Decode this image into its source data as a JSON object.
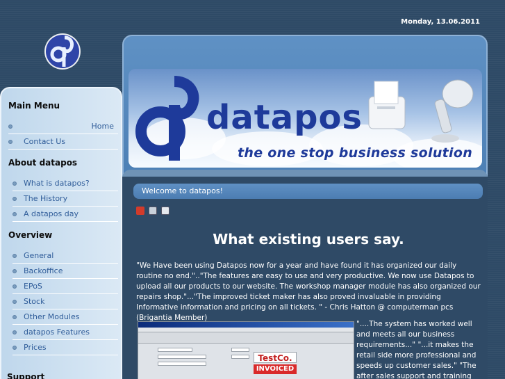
{
  "header": {
    "date": "Monday, 13.06.2011"
  },
  "banner": {
    "brand_word": "datapos",
    "tagline": "the one stop business solution"
  },
  "sidebar": {
    "sections": [
      {
        "heading": "Main Menu",
        "items": [
          {
            "label": "Home"
          },
          {
            "label": "Contact Us"
          }
        ]
      },
      {
        "heading": "About datapos",
        "items": [
          {
            "label": "What is datapos?"
          },
          {
            "label": "The History"
          },
          {
            "label": "A datapos day"
          }
        ]
      },
      {
        "heading": "Overview",
        "items": [
          {
            "label": "General"
          },
          {
            "label": "Backoffice"
          },
          {
            "label": "EPoS"
          },
          {
            "label": "Stock"
          },
          {
            "label": "Other Modules"
          },
          {
            "label": "datapos Features"
          },
          {
            "label": "Prices"
          }
        ]
      }
    ],
    "support_heading": "Support"
  },
  "content": {
    "welcome": "Welcome to datapos!",
    "icons": [
      "pdf-icon",
      "print-icon",
      "email-icon"
    ],
    "heading": "What existing users say.",
    "quote1": "\"We Have been using Datapos now for a year and have found it has organized our daily routine no end.\"..\"The  features are easy to use and very productive.  We now use Datapos to upload all our products to our website. The workshop manager module has also organized our repairs shop.\"...\"The improved ticket maker has also proved invaluable in providing Informative information and pricing on all tickets. \" - Chris Hatton @ computerman pcs (Brigantia Member)",
    "quote2": "\"....The system has worked well and meets all our business requirements...\" \"...it makes the retail side more professional and speeds up customer sales.\" \"The after sales support and training from dcl was first",
    "screenshot": {
      "logo_text": "TestCo.",
      "status_text": "INVOICED"
    }
  }
}
